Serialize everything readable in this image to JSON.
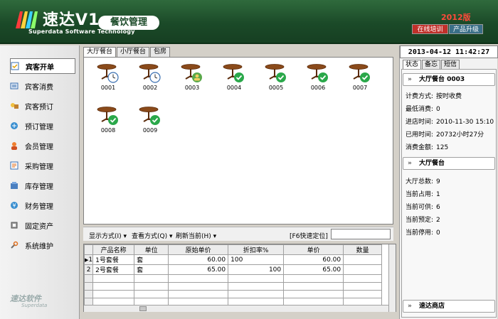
{
  "header": {
    "brand": "速达V1",
    "brand_sub": "Superdata Software Technology",
    "module": "餐饮管理",
    "year": "2012版",
    "btn_training": "在线培训",
    "btn_upgrade": "产品升级"
  },
  "sidebar": {
    "items": [
      {
        "label": "宾客开单",
        "icon": "open-order-icon"
      },
      {
        "label": "宾客消费",
        "icon": "consumption-icon"
      },
      {
        "label": "宾客预订",
        "icon": "reservation-icon"
      },
      {
        "label": "预订管理",
        "icon": "booking-manage-icon"
      },
      {
        "label": "会员管理",
        "icon": "member-icon"
      },
      {
        "label": "采购管理",
        "icon": "purchase-icon"
      },
      {
        "label": "库存管理",
        "icon": "inventory-icon"
      },
      {
        "label": "财务管理",
        "icon": "finance-icon"
      },
      {
        "label": "固定资产",
        "icon": "assets-icon"
      },
      {
        "label": "系统维护",
        "icon": "maintenance-icon"
      }
    ],
    "watermark": "速达软件",
    "watermark_sub": "Superdata"
  },
  "tabs": [
    "大厅餐台",
    "小厅餐台",
    "包房"
  ],
  "tables": [
    {
      "no": "0001",
      "status": "clock"
    },
    {
      "no": "0002",
      "status": "clock"
    },
    {
      "no": "0003",
      "status": "reserved"
    },
    {
      "no": "0004",
      "status": "ok"
    },
    {
      "no": "0005",
      "status": "ok"
    },
    {
      "no": "0006",
      "status": "ok"
    },
    {
      "no": "0007",
      "status": "ok"
    },
    {
      "no": "0008",
      "status": "ok"
    },
    {
      "no": "0009",
      "status": "ok"
    }
  ],
  "toolbar": {
    "display": "显示方式(I)",
    "view": "查看方式(Q)",
    "refresh": "刷新当前(H)",
    "quick": "[F6快速定位]"
  },
  "grid": {
    "columns": [
      "产品名称",
      "单位",
      "原始单价",
      "折扣率%",
      "单价",
      "数量"
    ],
    "rows": [
      {
        "idx": "1",
        "name": "1号套餐",
        "unit": "套",
        "orig": "60.00",
        "disc": "100",
        "price": "60.00",
        "qty": ""
      },
      {
        "idx": "2",
        "name": "2号套餐",
        "unit": "套",
        "orig": "65.00",
        "disc": "100",
        "price": "65.00",
        "qty": ""
      }
    ]
  },
  "right": {
    "datetime": "2013-04-12 11:42:27",
    "tabs": [
      "状态",
      "备忘",
      "短信"
    ],
    "table_title": "大厅餐台 0003",
    "table_info": [
      {
        "k": "计费方式:",
        "v": "按时收费"
      },
      {
        "k": "最低消费:",
        "v": "0"
      },
      {
        "k": "进店时间:",
        "v": "2010-11-30 15:10"
      },
      {
        "k": "已用时间:",
        "v": "20732小时27分"
      },
      {
        "k": "消费金额:",
        "v": "125"
      }
    ],
    "hall_title": "大厅餐台",
    "hall_info": [
      {
        "k": "大厅总数:",
        "v": "9"
      },
      {
        "k": "当前占用:",
        "v": "1"
      },
      {
        "k": "当前可供:",
        "v": "6"
      },
      {
        "k": "当前预定:",
        "v": "2"
      },
      {
        "k": "当前停用:",
        "v": "0"
      }
    ],
    "shop_title": "速达商店"
  }
}
